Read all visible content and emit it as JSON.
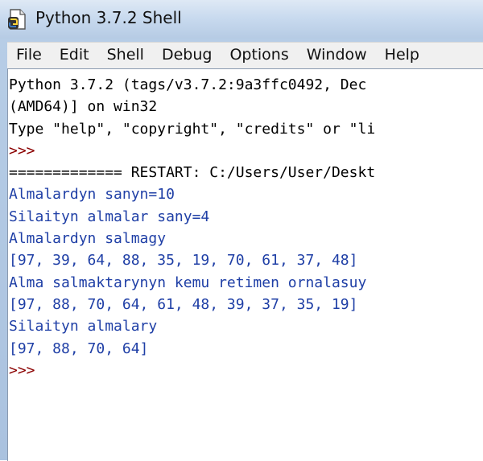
{
  "window": {
    "title": "Python 3.7.2 Shell"
  },
  "menu": {
    "items": [
      "File",
      "Edit",
      "Shell",
      "Debug",
      "Options",
      "Window",
      "Help"
    ]
  },
  "shell": {
    "lines": [
      {
        "text": "Python 3.7.2 (tags/v3.7.2:9a3ffc0492, Dec ",
        "kind": "banner"
      },
      {
        "text": "(AMD64)] on win32",
        "kind": "banner"
      },
      {
        "text": "Type \"help\", \"copyright\", \"credits\" or \"li",
        "kind": "banner"
      },
      {
        "text": ">>> ",
        "kind": "prompt"
      },
      {
        "text": "============= RESTART: C:/Users/User/Deskt",
        "kind": "banner"
      },
      {
        "text": "Almalardyn sanyn=10",
        "kind": "output"
      },
      {
        "text": "Silaityn almalar sany=4",
        "kind": "output"
      },
      {
        "text": "Almalardyn salmagy",
        "kind": "output"
      },
      {
        "text": "[97, 39, 64, 88, 35, 19, 70, 61, 37, 48]",
        "kind": "output"
      },
      {
        "text": "Alma salmaktarynyn kemu retimen ornalasuy",
        "kind": "output"
      },
      {
        "text": "[97, 88, 70, 64, 61, 48, 39, 37, 35, 19]",
        "kind": "output"
      },
      {
        "text": "Silaityn almalary",
        "kind": "output"
      },
      {
        "text": "[97, 88, 70, 64]",
        "kind": "output"
      },
      {
        "text": ">>> ",
        "kind": "prompt"
      }
    ]
  },
  "colors": {
    "banner": "#000000",
    "prompt": "#8b0000",
    "output": "#1f3fa6"
  },
  "icons": {
    "title": "python-shell-icon"
  }
}
